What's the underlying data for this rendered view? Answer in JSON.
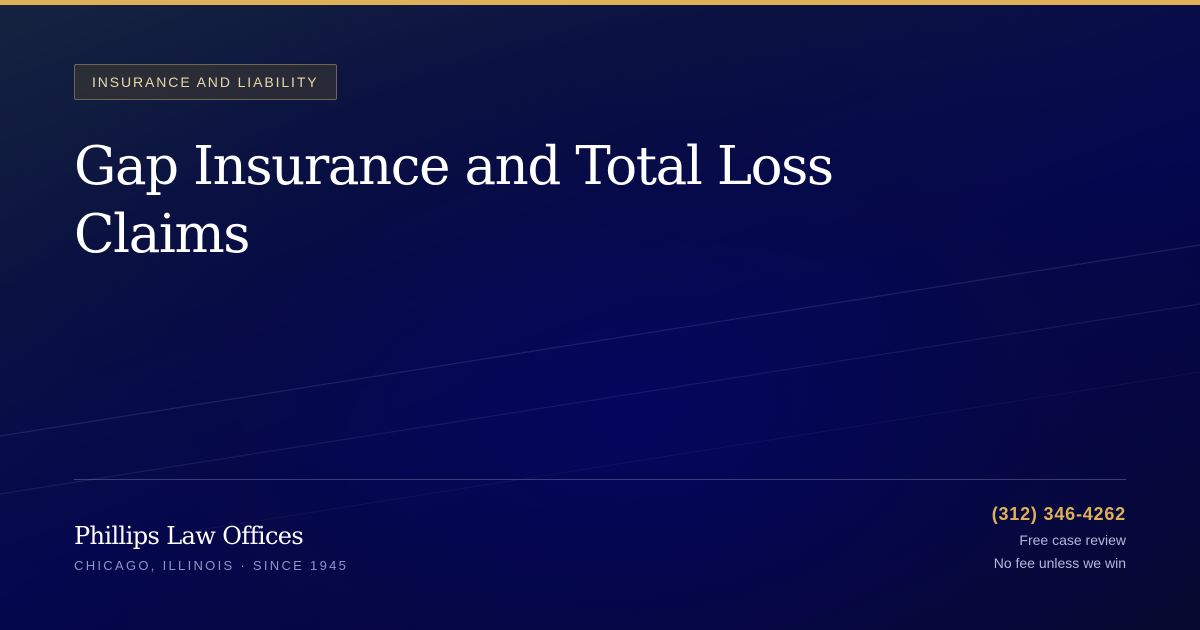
{
  "category": "INSURANCE AND LIABILITY",
  "title": "Gap Insurance and Total Loss Claims",
  "firm": {
    "name": "Phillips Law Offices",
    "tagline": "CHICAGO, ILLINOIS · SINCE 1945"
  },
  "contact": {
    "phone": "(312) 346-4262",
    "line1": "Free case review",
    "line2": "No fee unless we win"
  },
  "colors": {
    "accent": "#e0b058",
    "background": "#06083a",
    "title": "#ffffff",
    "muted": "#8d95c4"
  }
}
